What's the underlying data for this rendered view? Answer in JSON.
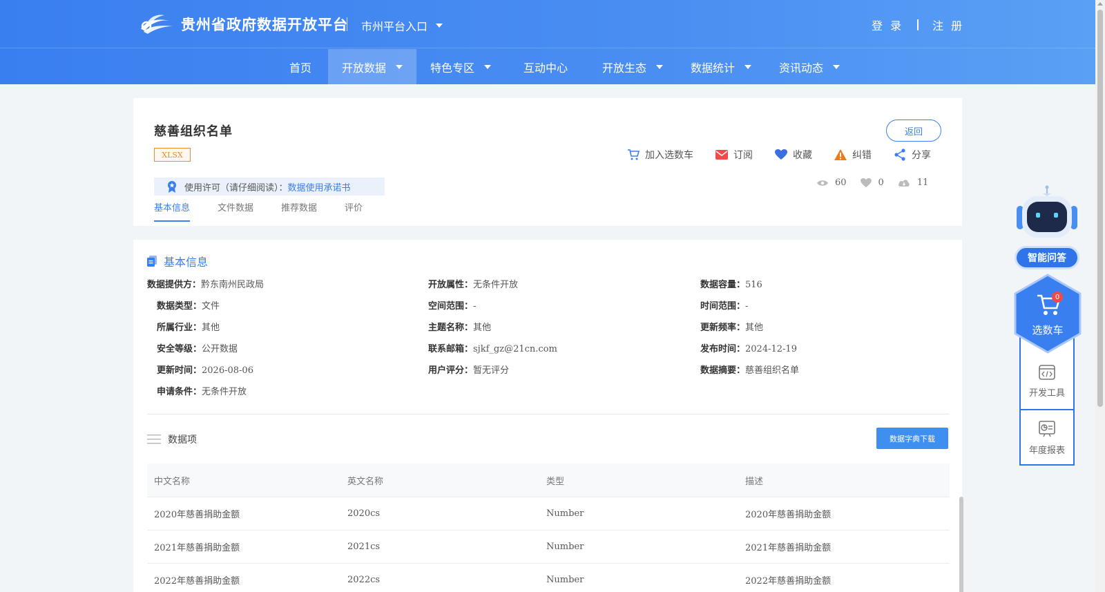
{
  "header": {
    "site_title": "贵州省政府数据开放平台",
    "city_entry": "市州平台入口",
    "login": "登 录",
    "register": "注 册"
  },
  "nav": [
    {
      "label": "首页",
      "dropdown": false,
      "active": false
    },
    {
      "label": "开放数据",
      "dropdown": true,
      "active": true
    },
    {
      "label": "特色专区",
      "dropdown": true,
      "active": false
    },
    {
      "label": "互动中心",
      "dropdown": false,
      "active": false
    },
    {
      "label": "开放生态",
      "dropdown": true,
      "active": false
    },
    {
      "label": "数据统计",
      "dropdown": true,
      "active": false
    },
    {
      "label": "资讯动态",
      "dropdown": true,
      "active": false
    }
  ],
  "dataset": {
    "title": "慈善组织名单",
    "format": "XLSX",
    "back": "返回",
    "actions": {
      "cart": "加入选数车",
      "subscribe": "订阅",
      "favorite": "收藏",
      "report": "纠错",
      "share": "分享"
    },
    "license_label": "使用许可（请仔细阅读）：",
    "license_link": "数据使用承诺书",
    "stats": {
      "views": "60",
      "likes": "0",
      "downloads": "11"
    },
    "tabs": [
      "基本信息",
      "文件数据",
      "推荐数据",
      "评价"
    ]
  },
  "basic_info": {
    "heading": "基本信息",
    "fields": [
      {
        "label": "数据提供方：",
        "value": "黔东南州民政局"
      },
      {
        "label": "开放属性：",
        "value": "无条件开放"
      },
      {
        "label": "数据容量：",
        "value": "516"
      },
      {
        "label": "数据类型：",
        "value": "文件"
      },
      {
        "label": "空间范围：",
        "value": "-"
      },
      {
        "label": "时间范围：",
        "value": "-"
      },
      {
        "label": "所属行业：",
        "value": "其他"
      },
      {
        "label": "主题名称：",
        "value": "其他"
      },
      {
        "label": "更新频率：",
        "value": "其他"
      },
      {
        "label": "安全等级：",
        "value": "公开数据"
      },
      {
        "label": "联系邮箱：",
        "value": "sjkf_gz@21cn.com"
      },
      {
        "label": "发布时间：",
        "value": "2024-12-19"
      },
      {
        "label": "更新时间：",
        "value": "2026-08-06"
      },
      {
        "label": "用户评分：",
        "value": "暂无评分"
      },
      {
        "label": "数据摘要：",
        "value": "慈善组织名单"
      },
      {
        "label": "申请条件：",
        "value": "无条件开放"
      }
    ]
  },
  "data_items": {
    "heading": "数据项",
    "dict_download": "数据字典下载",
    "columns": [
      "中文名称",
      "英文名称",
      "类型",
      "描述"
    ],
    "rows": [
      [
        "2020年慈善捐助金额",
        "2020cs",
        "Number",
        "2020年慈善捐助金额"
      ],
      [
        "2021年慈善捐助金额",
        "2021cs",
        "Number",
        "2021年慈善捐助金额"
      ],
      [
        "2022年慈善捐助金额",
        "2022cs",
        "Number",
        "2022年慈善捐助金额"
      ]
    ]
  },
  "sidebar": {
    "ai_qa": "智能问答",
    "cart_label": "选数车",
    "cart_count": "0",
    "dev_tools": "开发工具",
    "annual_report": "年度报表"
  },
  "colors": {
    "brand": "#3a7ff0",
    "badge": "#f08a2a",
    "alert": "#f04a4a"
  }
}
